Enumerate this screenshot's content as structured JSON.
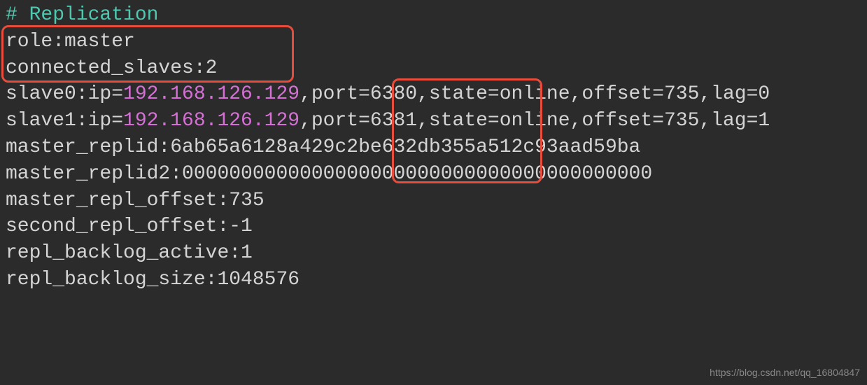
{
  "terminal": {
    "header": "# Replication",
    "role_line": "role:master",
    "connected_slaves_line": "connected_slaves:2",
    "slave0_prefix": "slave0:ip=",
    "slave0_ip": "192.168.126.129",
    "slave0_suffix": ",port=6380,state=online,offset=735,lag=0",
    "slave1_prefix": "slave1:ip=",
    "slave1_ip": "192.168.126.129",
    "slave1_suffix": ",port=6381,state=online,offset=735,lag=1",
    "master_replid": "master_replid:6ab65a6128a429c2be632db355a512c93aad59ba",
    "master_replid2": "master_replid2:0000000000000000000000000000000000000000",
    "master_repl_offset": "master_repl_offset:735",
    "second_repl_offset": "second_repl_offset:-1",
    "repl_backlog_active": "repl_backlog_active:1",
    "repl_backlog_size": "repl_backlog_size:1048576"
  },
  "watermark": "https://blog.csdn.net/qq_16804847"
}
